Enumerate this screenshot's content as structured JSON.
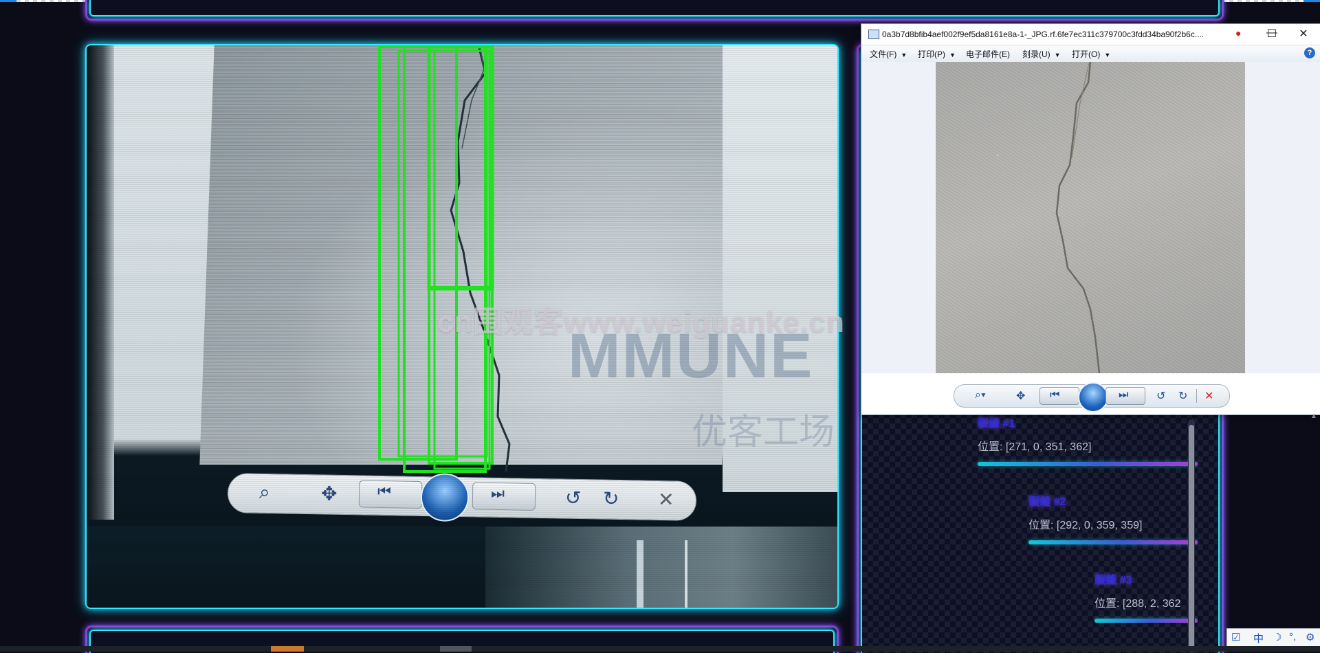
{
  "viewer": {
    "title": "0a3b7d8bfib4aef002f9ef5da8161e8a-1-_JPG.rf.6fe7ec311c379700c3fdd34ba90f2b6c....",
    "menus": [
      {
        "label": "文件(F)"
      },
      {
        "label": "打印(P)"
      },
      {
        "label": "电子邮件(E)"
      },
      {
        "label": "刻录(U)"
      },
      {
        "label": "打开(O)"
      }
    ],
    "help": "?",
    "minimize": "—",
    "maximize": "☐",
    "close": "✕"
  },
  "watermark": "cn围观客www.weiguanke.cn",
  "feed_watermark": {
    "word": "MMUNE",
    "cn": "优客工场"
  },
  "cracks": [
    {
      "title": "裂缝 #1",
      "position": "位置: [271, 0, 351, 362]"
    },
    {
      "title": "裂缝 #2",
      "position": "位置: [292, 0, 359, 359]"
    },
    {
      "title": "裂缝 #3",
      "position": "位置: [288, 2, 362"
    }
  ],
  "ime": {
    "check": "☑",
    "lang": "中",
    "moon": "☽",
    "punct": "°,",
    "gear": "⚙"
  },
  "colors": {
    "neon_cyan": "#35e6ff",
    "neon_purple": "#8a33d6",
    "detection_box": "#22e022",
    "crack_title": "#2f2fd0"
  }
}
